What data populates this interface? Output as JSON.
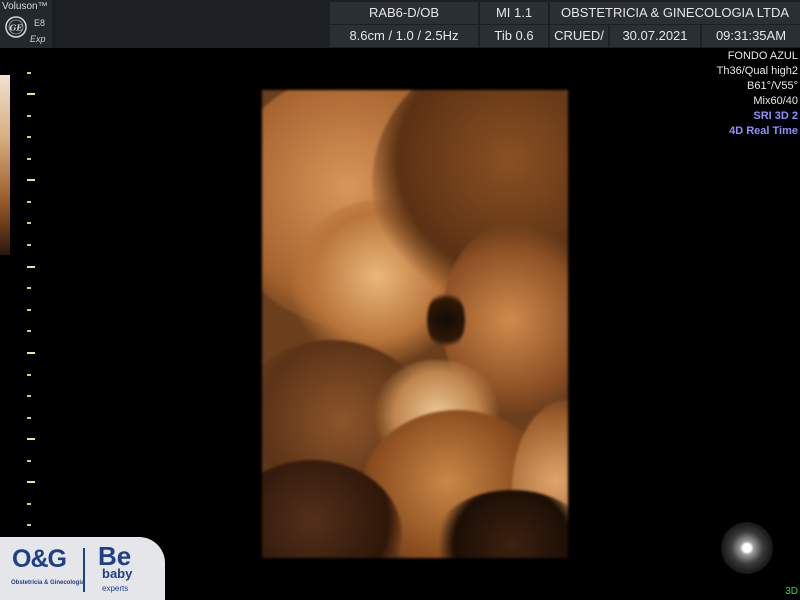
{
  "header": {
    "brand": "Voluson™",
    "model": "E8",
    "variant": "Exp",
    "probe": "RAB6-D/OB",
    "mi": "MI  1.1",
    "institution": "OBSTETRICIA & GINECOLOGIA LTDA",
    "depth_params": "8.6cm / 1.0 / 2.5Hz",
    "tib": "Tib  0.6",
    "operator": "CRUED/",
    "date": "30.07.2021",
    "time": "09:31:35AM"
  },
  "params": [
    {
      "text": "FONDO AZUL",
      "color": "white"
    },
    {
      "text": "Th36/Qual high2",
      "color": "white"
    },
    {
      "text": "B61°/V55°",
      "color": "white"
    },
    {
      "text": "Mix60/40",
      "color": "white"
    },
    {
      "text": "SRI 3D 2",
      "color": "blue"
    },
    {
      "text": "4D Real Time",
      "color": "blue"
    }
  ],
  "logo": {
    "og": "O&G",
    "og_subtitle": "Obstetricia & Ginecología",
    "be": "Be",
    "baby": "baby",
    "experts": "experts"
  },
  "mode_indicator": "3D",
  "colors": {
    "header_bg": "#1c2024",
    "cell_bg": "#2a2f34",
    "blue_text": "#8f8fff",
    "green_text": "#3fd23f",
    "logo_blue": "#1f3f86"
  }
}
